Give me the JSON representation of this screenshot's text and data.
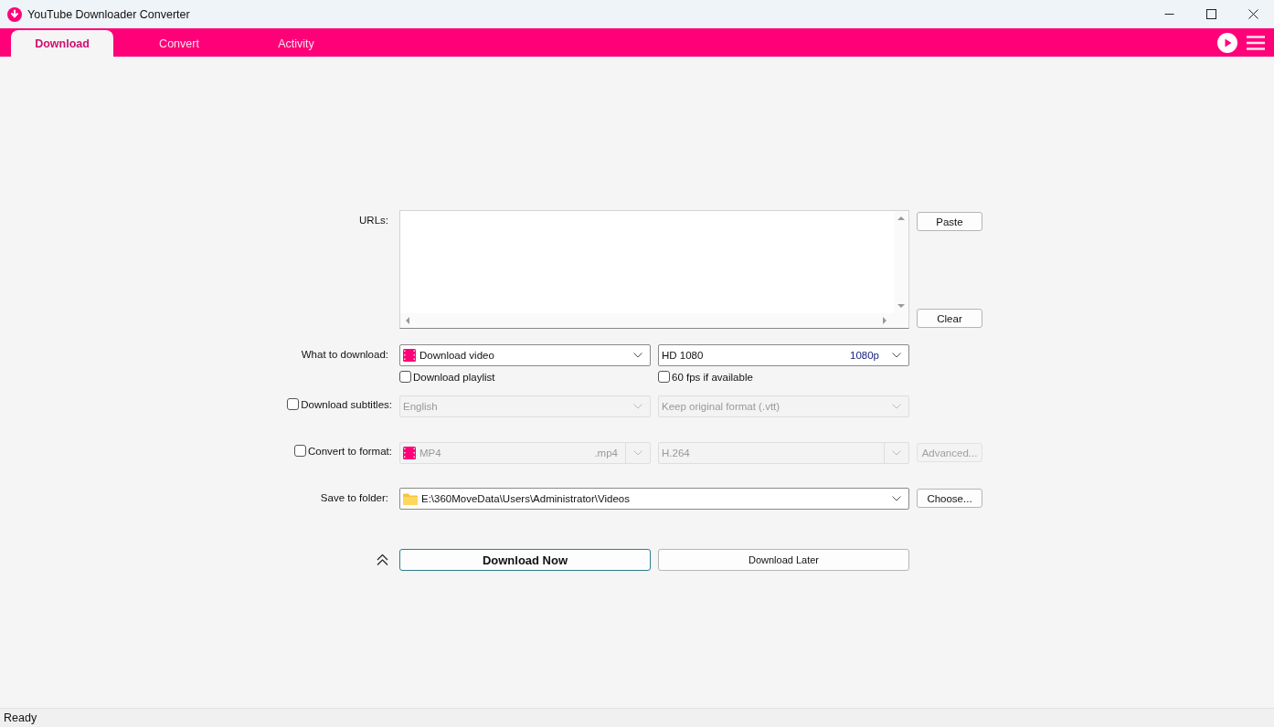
{
  "window": {
    "title": "YouTube Downloader Converter"
  },
  "tabs": [
    {
      "label": "Download",
      "selected": true
    },
    {
      "label": "Convert",
      "selected": false
    },
    {
      "label": "Activity",
      "selected": false
    }
  ],
  "form": {
    "urls": {
      "label": "URLs:",
      "paste_button": "Paste",
      "clear_button": "Clear"
    },
    "what_to_download": {
      "label": "What to download:",
      "type": "Download video",
      "quality": "HD 1080",
      "quality_badge": "1080p",
      "playlist": {
        "label": "Download playlist",
        "checked": false
      },
      "fps": {
        "label": "60 fps if available",
        "checked": false
      }
    },
    "subtitles": {
      "label": "Download subtitles:",
      "checked": false,
      "disabled": true,
      "language": "English",
      "format": "Keep original format (.vtt)"
    },
    "convert": {
      "label": "Convert to format:",
      "checked": false,
      "disabled": true,
      "format": "MP4",
      "extension": ".mp4",
      "codec": "H.264",
      "advanced_button": "Advanced..."
    },
    "save": {
      "label": "Save to folder:",
      "path": "E:\\360MoveData\\Users\\Administrator\\Videos",
      "choose_button": "Choose..."
    },
    "actions": {
      "download_now": "Download Now",
      "download_later": "Download Later"
    }
  },
  "status_bar": {
    "text": "Ready"
  }
}
